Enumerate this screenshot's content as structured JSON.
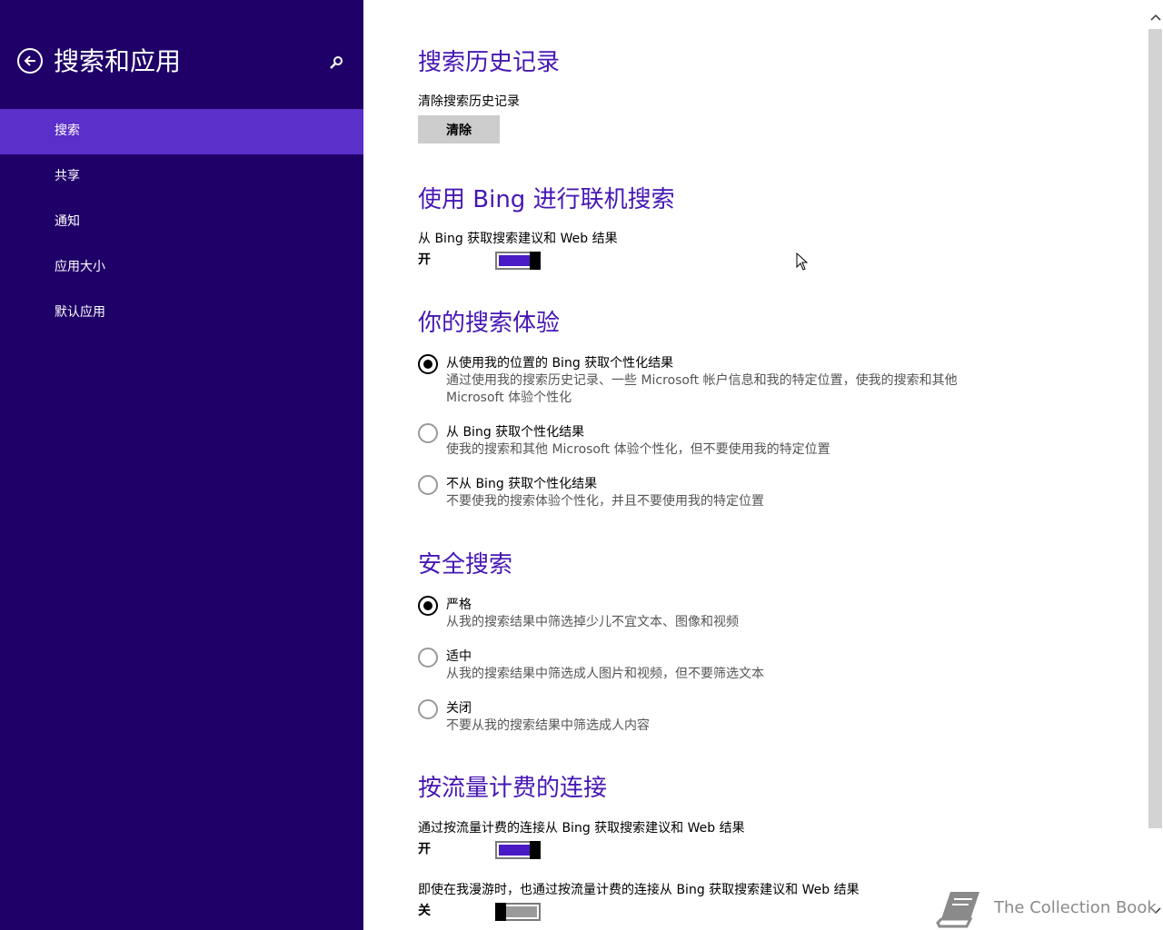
{
  "sidebar": {
    "title": "搜索和应用",
    "back_icon": "back-arrow-icon",
    "search_icon": "search-icon",
    "items": [
      {
        "label": "搜索",
        "active": true
      },
      {
        "label": "共享",
        "active": false
      },
      {
        "label": "通知",
        "active": false
      },
      {
        "label": "应用大小",
        "active": false
      },
      {
        "label": "默认应用",
        "active": false
      }
    ]
  },
  "history": {
    "title": "搜索历史记录",
    "label": "清除搜索历史记录",
    "clear_button": "清除"
  },
  "bing_online": {
    "title": "使用 Bing 进行联机搜索",
    "label": "从 Bing 获取搜索建议和 Web 结果",
    "state": "开",
    "on": true
  },
  "experience": {
    "title": "你的搜索体验",
    "options": [
      {
        "label": "从使用我的位置的 Bing 获取个性化结果",
        "desc": "通过使用我的搜索历史记录、一些 Microsoft 帐户信息和我的特定位置，使我的搜索和其他 Microsoft 体验个性化",
        "checked": true
      },
      {
        "label": "从 Bing 获取个性化结果",
        "desc": "使我的搜索和其他 Microsoft 体验个性化，但不要使用我的特定位置",
        "checked": false
      },
      {
        "label": "不从 Bing 获取个性化结果",
        "desc": "不要使我的搜索体验个性化，并且不要使用我的特定位置",
        "checked": false
      }
    ]
  },
  "safe_search": {
    "title": "安全搜索",
    "options": [
      {
        "label": "严格",
        "desc": "从我的搜索结果中筛选掉少儿不宜文本、图像和视频",
        "checked": true
      },
      {
        "label": "适中",
        "desc": "从我的搜索结果中筛选成人图片和视频，但不要筛选文本",
        "checked": false
      },
      {
        "label": "关闭",
        "desc": "不要从我的搜索结果中筛选成人内容",
        "checked": false
      }
    ]
  },
  "metered": {
    "title": "按流量计费的连接",
    "setting1": {
      "label": "通过按流量计费的连接从 Bing 获取搜索建议和 Web 结果",
      "state": "开",
      "on": true
    },
    "setting2": {
      "label": "即使在我漫游时，也通过按流量计费的连接从 Bing 获取搜索建议和 Web 结果",
      "state": "关",
      "on": false
    }
  },
  "watermark": {
    "text": "The Collection Book",
    "icon": "book-icon"
  },
  "colors": {
    "sidebar_bg": "#1f0068",
    "sidebar_active": "#5b2fc9",
    "accent": "#4617b4"
  }
}
